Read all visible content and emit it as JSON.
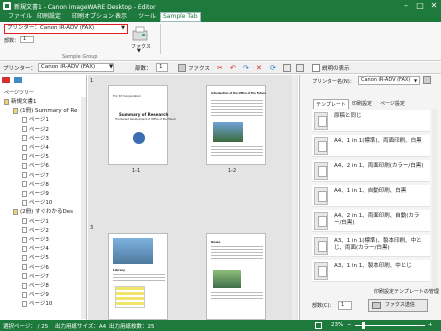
{
  "window": {
    "title": "新規文書1 - Canon imageWARE Desktop - Editor",
    "minimize": "–",
    "maximize": "□",
    "close": "✕"
  },
  "menu": [
    "ファイル",
    "印刷設定",
    "印刷オプション",
    "表示",
    "ツール",
    "Sample Tab"
  ],
  "ribbon": {
    "printer_label": "プリンター：Canon iR-ADV (FAX)",
    "copies_label": "部数：",
    "copies_value": "1",
    "fax_label": "ファクス",
    "group_label": "Sample Group"
  },
  "toolbar": {
    "printer_label": "プリンター：",
    "printer_value": "Canon iR-ADV (FAX)",
    "copies_label": "部数：",
    "copies_value": "1",
    "fax_label": "ファクス",
    "preview_label": "説明の表示"
  },
  "left_panel": {
    "header": "ページツリー",
    "tree": [
      {
        "label": "新規文書1",
        "level": 0
      },
      {
        "label": "(1冊) Summary of Re",
        "level": 1
      },
      {
        "label": "ページ1",
        "level": 2
      },
      {
        "label": "ページ2",
        "level": 2
      },
      {
        "label": "ページ3",
        "level": 2
      },
      {
        "label": "ページ4",
        "level": 2
      },
      {
        "label": "ページ5",
        "level": 2
      },
      {
        "label": "ページ6",
        "level": 2
      },
      {
        "label": "ページ7",
        "level": 2
      },
      {
        "label": "ページ8",
        "level": 2
      },
      {
        "label": "ページ9",
        "level": 2
      },
      {
        "label": "ページ10",
        "level": 2
      },
      {
        "label": "(2冊) すぐわかるDes",
        "level": 1
      },
      {
        "label": "ページ1",
        "level": 2
      },
      {
        "label": "ページ2",
        "level": 2
      },
      {
        "label": "ページ3",
        "level": 2
      },
      {
        "label": "ページ4",
        "level": 2
      },
      {
        "label": "ページ5",
        "level": 2
      },
      {
        "label": "ページ6",
        "level": 2
      },
      {
        "label": "ページ7",
        "level": 2
      },
      {
        "label": "ページ8",
        "level": 2
      },
      {
        "label": "ページ9",
        "level": 2
      },
      {
        "label": "ページ10",
        "level": 2
      }
    ]
  },
  "center": {
    "pages": [
      {
        "num": "1",
        "caption": "1-1",
        "title": "Summary of Research",
        "subtitle": "The Recent Development of 'Office of the Future'",
        "label": "For ST Corporation"
      },
      {
        "num": "",
        "caption": "1-2",
        "title": "Introduction of the Office of the Future"
      },
      {
        "num": "3",
        "caption": "",
        "title": "Library"
      },
      {
        "num": "4",
        "caption": "",
        "title": "Noise"
      }
    ]
  },
  "right_panel": {
    "printer_label": "プリンター名(N)：",
    "printer_value": "Canon iR-ADV (FAX)",
    "tabs": [
      "テンプレート",
      "印刷設定",
      "ページ設定"
    ],
    "templates": [
      "原稿と同じ",
      "A4、1 in 1(標準)、両面印刷、白黒",
      "A4、2 in 1、両面印刷(カラー/白黒)",
      "A4、1 in 1、自動印刷、白黒",
      "A4、2 in 1、両面印刷、自動(カラー/白黒)",
      "A3、1 in 1(標準)、製本印刷、中とじ、両面(カラー/白黒)",
      "A3、1 in 1、製本印刷、中とじ"
    ],
    "template_manage": "印刷設定テンプレートの管理",
    "copies_label": "部数(C)：",
    "copies_value": "1",
    "send_fax": "ファクス送信"
  },
  "status": {
    "selected_page": "選択ページ： / 25",
    "output_size": "出力用紙サイズ：A4",
    "output_pages": "出力用紙枚数：25",
    "zoom": "23%"
  }
}
